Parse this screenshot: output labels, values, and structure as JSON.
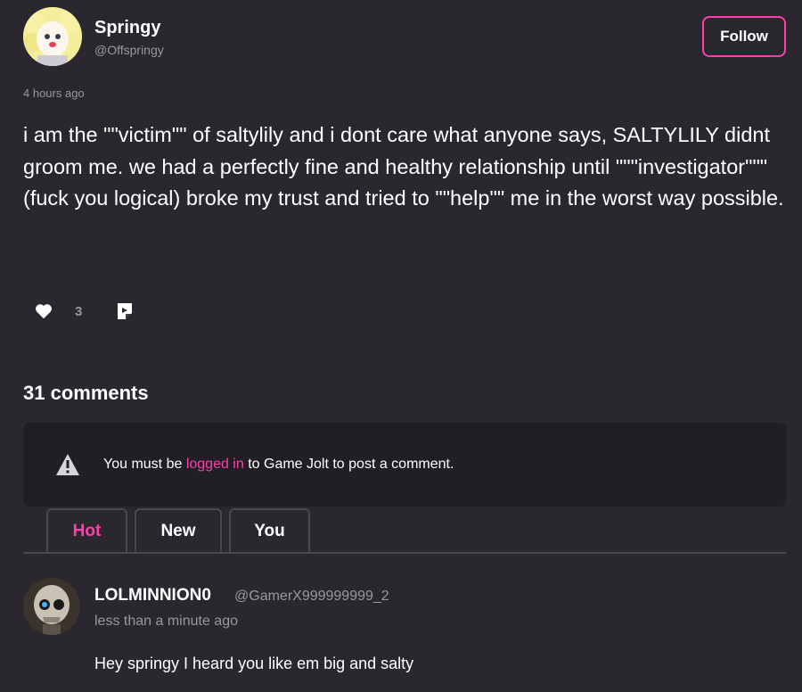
{
  "post": {
    "author_name": "Springy",
    "author_handle": "@Offspringy",
    "follow_label": "Follow",
    "timestamp": "4 hours ago",
    "body": "i am the \"\"victim\"\" of saltylily and i dont care what anyone says, SALTYLILY didnt groom me. we had a perfectly fine and healthy relationship until \"\"\"investigator\"\"\" (fuck you logical) broke my trust and tried to \"\"help\"\" me in the worst way possible.",
    "like_count": "3",
    "icons": {
      "like": "heart-icon",
      "share": "share-icon"
    }
  },
  "comments": {
    "heading": "31 comments",
    "notice_prefix": "You must be ",
    "notice_link": "logged in",
    "notice_suffix": " to Game Jolt to post a comment.",
    "tabs": [
      {
        "label": "Hot",
        "active": true
      },
      {
        "label": "New",
        "active": false
      },
      {
        "label": "You",
        "active": false
      }
    ],
    "items": [
      {
        "author": "LOLMINNION0",
        "handle": "@GamerX999999999_2",
        "time": "less than a minute ago",
        "text": "Hey springy I heard you like em big and salty"
      }
    ]
  },
  "colors": {
    "background": "#2a272f",
    "accent": "#ff3fac",
    "muted": "#9a97a0",
    "panel": "#211f25"
  }
}
